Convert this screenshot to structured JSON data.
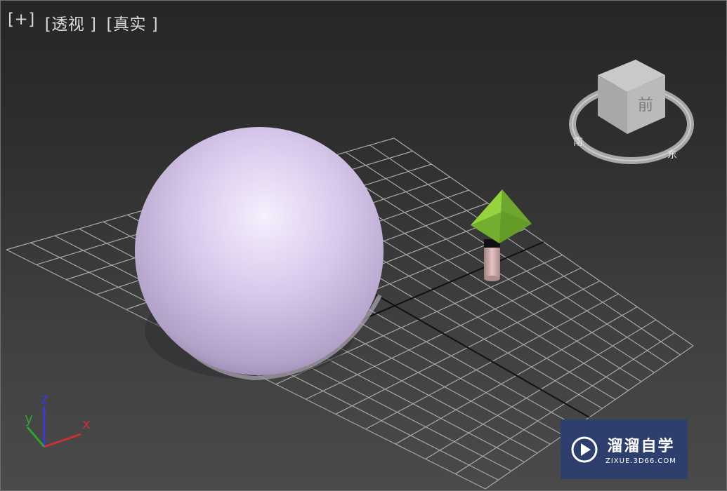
{
  "viewport": {
    "menu_label": "[+]",
    "view_label": "[透视 ]",
    "shading_label": "[真实 ]"
  },
  "axes": {
    "x": "x",
    "y": "y",
    "z": "z",
    "x_color": "#c83232",
    "y_color": "#32a032",
    "z_color": "#3a3ad8"
  },
  "viewcube": {
    "face_label": "前",
    "compass": [
      "南",
      "东"
    ]
  },
  "objects": {
    "sphere_color": "#d9c9ee",
    "pyramid_color": "#8cc83c",
    "cylinder_color": "#d8b0b0",
    "grid_color": "#a8a8a8"
  },
  "watermark": {
    "title": "溜溜自学",
    "subtitle": "ZIXUE.3D66.COM",
    "bg_color": "#2e3f6e"
  }
}
